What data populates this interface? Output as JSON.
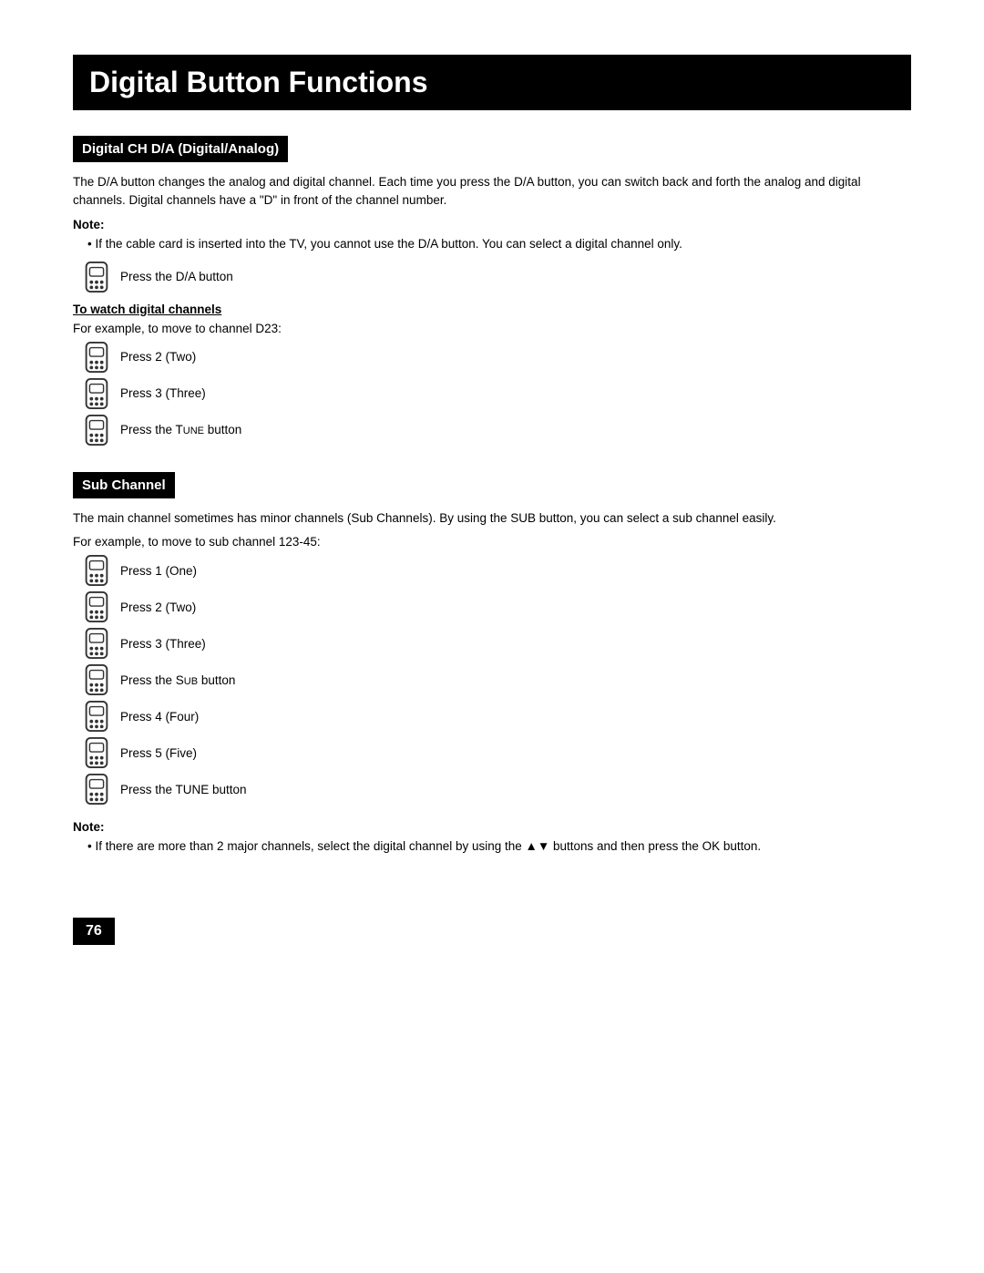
{
  "page": {
    "title": "Digital Button Functions",
    "page_number": "76"
  },
  "section1": {
    "header": "Digital CH D/A (Digital/Analog)",
    "body1": "The D/A button changes the analog and digital channel.  Each time you press the D/A button, you can switch back and forth the analog and digital channels.  Digital channels have a \"D\" in front of the channel number.",
    "note_label": "Note:",
    "note_text": "If the cable card is inserted into the TV, you cannot use the D/A button.  You can select a digital channel only.",
    "da_step": "Press the D/A button",
    "watch_label": "To watch digital channels",
    "example_text": "For example, to move to channel D23:",
    "steps": [
      {
        "text": "Press 2 (Two)"
      },
      {
        "text": "Press 3 (Three)"
      },
      {
        "text": "Press the TUNE button",
        "tune_styled": true
      }
    ]
  },
  "section2": {
    "header": "Sub Channel",
    "body1": "The main channel sometimes has minor channels (Sub Channels).  By using the SUB button, you can select a sub channel easily.",
    "example_text": "For example, to move to sub channel 123-45:",
    "steps": [
      {
        "text": "Press 1 (One)"
      },
      {
        "text": "Press 2 (Two)"
      },
      {
        "text": "Press 3 (Three)"
      },
      {
        "text": "Press the SUB button",
        "sub_styled": true
      },
      {
        "text": "Press 4 (Four)"
      },
      {
        "text": "Press 5 (Five)"
      },
      {
        "text": "Press the TUNE button",
        "tune_styled": true
      }
    ],
    "note_label": "Note:",
    "note_text": "If there are more than 2 major channels, select the digital channel by using the ▲▼ buttons and then press the OK button."
  }
}
